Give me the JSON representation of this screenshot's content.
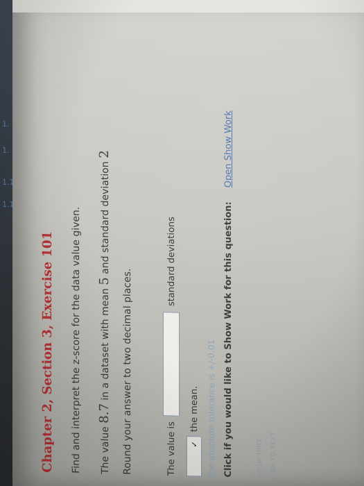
{
  "exercise": {
    "title": "Chapter 2, Section 3, Exercise 101"
  },
  "question": {
    "line1": "Find and interpret the z-score for the data value given.",
    "line2_prefix": "The value ",
    "value": "8.7",
    "line2_mid": " in a dataset with mean ",
    "mean": "5",
    "line2_mid2": " and standard deviation ",
    "sd": "2",
    "line3": "Round your answer to two decimal places."
  },
  "answer": {
    "prefix": "The value is",
    "input_value": "",
    "suffix": "standard deviations",
    "select_value": "",
    "after_select": "the mean.",
    "tolerance": "the absolute tolerance is +/-0.01"
  },
  "show_work": {
    "prompt": "Click if you would like to Show Work for this question:",
    "link": "Open Show Work"
  },
  "links": {
    "show_hint": "SHOW HINT",
    "link_to_text": "LINK TO TEXT"
  },
  "left_strip": {
    "marks": [
      "1.",
      "1.",
      "1.1",
      "1.1"
    ]
  }
}
